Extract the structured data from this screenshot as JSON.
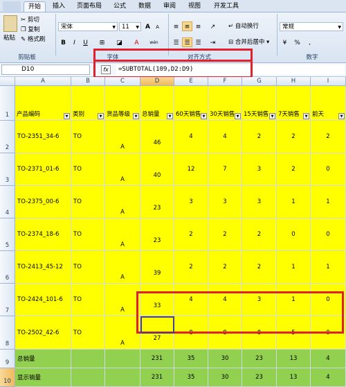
{
  "tabs": [
    "开始",
    "插入",
    "页面布局",
    "公式",
    "数据",
    "审阅",
    "视图",
    "开发工具"
  ],
  "ribbon": {
    "clipboard": {
      "paste": "粘贴",
      "cut": "剪切",
      "copy": "复制",
      "format_painter": "格式刷",
      "label": "剪贴板"
    },
    "font": {
      "name": "宋体",
      "size": "11",
      "bold": "B",
      "italic": "I",
      "underline": "U",
      "grow": "A",
      "shrink": "A",
      "wen": "wén",
      "label": "字体"
    },
    "alignment": {
      "wrap": "自动换行",
      "merge": "合并后居中",
      "label": "对齐方式"
    },
    "number": {
      "format": "常规",
      "label": "数字"
    }
  },
  "formula_bar": {
    "name_box": "D10",
    "fx": "fx",
    "formula": "=SUBTOTAL(109,D2:D9)"
  },
  "columns": [
    "A",
    "B",
    "C",
    "D",
    "E",
    "F",
    "G",
    "H",
    "I"
  ],
  "rows": [
    "1",
    "2",
    "3",
    "4",
    "5",
    "6",
    "7",
    "8",
    "9",
    "10"
  ],
  "headers": [
    "产品编码",
    "类别",
    "货品等级",
    "总销量",
    "60天销售",
    "30天销售",
    "15天销售",
    "7天销售",
    "前天"
  ],
  "data": [
    [
      "TO-2351_34-6",
      "TO",
      "A",
      "46",
      "4",
      "4",
      "2",
      "2",
      "2"
    ],
    [
      "TO-2371_01-6",
      "TO",
      "A",
      "40",
      "12",
      "7",
      "3",
      "2",
      "0"
    ],
    [
      "TO-2375_00-6",
      "TO",
      "A",
      "23",
      "3",
      "3",
      "3",
      "1",
      "1"
    ],
    [
      "TO-2374_18-6",
      "TO",
      "A",
      "23",
      "2",
      "2",
      "2",
      "0",
      "0"
    ],
    [
      "TO-2413_45-12",
      "TO",
      "A",
      "39",
      "2",
      "2",
      "2",
      "1",
      "1"
    ],
    [
      "TO-2424_101-6",
      "TO",
      "A",
      "33",
      "4",
      "4",
      "3",
      "1",
      "0"
    ],
    [
      "TO-2502_42-6",
      "TO",
      "A",
      "27",
      "8",
      "8",
      "8",
      "5",
      "0"
    ]
  ],
  "totals": [
    [
      "总销量",
      "",
      "",
      "231",
      "35",
      "30",
      "23",
      "13",
      "4"
    ],
    [
      "显示销量",
      "",
      "",
      "231",
      "35",
      "30",
      "23",
      "13",
      "4"
    ]
  ],
  "colors": {
    "data_fill": "#ffff00",
    "total_fill": "#92d050",
    "highlight": "#e0202a"
  }
}
